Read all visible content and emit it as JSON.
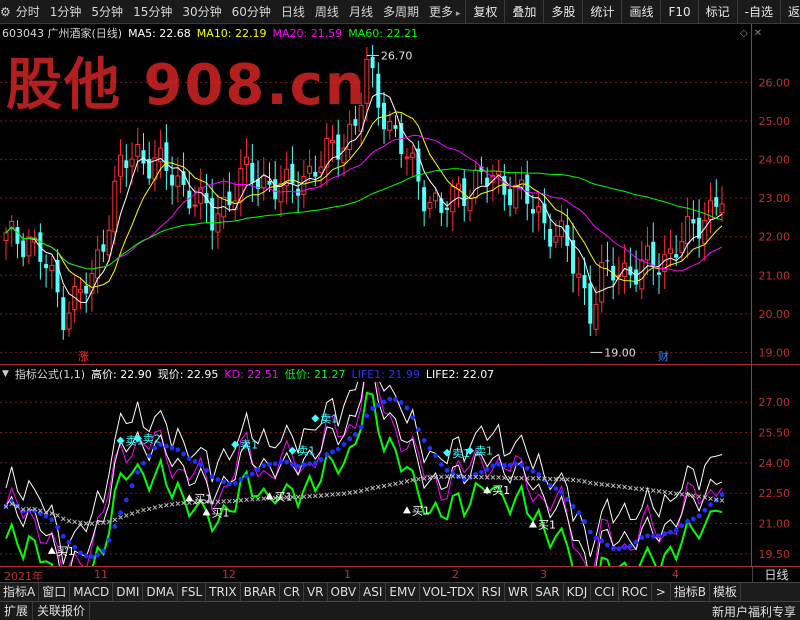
{
  "toolbar": {
    "periods": [
      "分时",
      "1分钟",
      "5分钟",
      "15分钟",
      "30分钟",
      "60分钟",
      "日线",
      "周线",
      "月线",
      "多周期",
      "更多"
    ],
    "tools": [
      "复权",
      "叠加",
      "多股",
      "统计",
      "画线",
      "F10",
      "标记",
      "-自选",
      "返回"
    ]
  },
  "watermark": "股他 908.cn",
  "main_legend": {
    "stock": "603043 广州酒家(日线)",
    "items": [
      {
        "label": "MA5: 22.68",
        "color": "#ffffff"
      },
      {
        "label": "MA10: 22.19",
        "color": "#ffff00"
      },
      {
        "label": "MA20: 21.59",
        "color": "#ff00ff"
      },
      {
        "label": "MA60: 22.21",
        "color": "#00ff00"
      }
    ]
  },
  "indicator_legend": {
    "name": "指标公式(1,1)",
    "items": [
      {
        "label": "高价: 22.90",
        "color": "#ffffff"
      },
      {
        "label": "现价: 22.95",
        "color": "#ffffff"
      },
      {
        "label": "KD: 22.51",
        "color": "#ff00ff"
      },
      {
        "label": "低价: 21.27",
        "color": "#00ff00"
      },
      {
        "label": "LIFE1: 21.99",
        "color": "#3030ff"
      },
      {
        "label": "LIFE2: 22.07",
        "color": "#ffffff"
      }
    ]
  },
  "chart_data": {
    "type": "candlestick",
    "price_axis": {
      "ticks": [
        "26.00",
        "25.00",
        "24.00",
        "23.00",
        "22.00",
        "21.00",
        "20.00",
        "19.00"
      ],
      "range": [
        18.7,
        27.1
      ]
    },
    "indicator_axis": {
      "ticks": [
        "27.00",
        "25.50",
        "24.00",
        "22.50",
        "21.00",
        "19.50"
      ],
      "range": [
        18.9,
        28.0
      ]
    },
    "annotations": {
      "high": "26.70",
      "low": "19.00",
      "rise_tag": "涨",
      "fin_tag": "财"
    },
    "time_axis": [
      "2021年",
      "11",
      "12",
      "1",
      "2",
      "3",
      "4"
    ],
    "period_label": "日线",
    "signals": {
      "buy": [
        {
          "label": "买1",
          "x": 8,
          "v": 19.6
        },
        {
          "label": "买1",
          "x": 32,
          "v": 22.2
        },
        {
          "label": "买1",
          "x": 35,
          "v": 21.5
        },
        {
          "label": "买1",
          "x": 46,
          "v": 22.3
        },
        {
          "label": "买1",
          "x": 70,
          "v": 21.6
        },
        {
          "label": "买1",
          "x": 84,
          "v": 22.6
        },
        {
          "label": "买1",
          "x": 92,
          "v": 20.9
        },
        {
          "label": "买1",
          "x": 95,
          "v": 18.6
        }
      ],
      "sell": [
        {
          "label": "卖1",
          "x": 20,
          "v": 25.1
        },
        {
          "label": "卖1",
          "x": 40,
          "v": 24.9
        },
        {
          "label": "卖1",
          "x": 50,
          "v": 24.6
        },
        {
          "label": "卖1",
          "x": 54,
          "v": 26.2
        },
        {
          "label": "卖1",
          "x": 77,
          "v": 24.5
        },
        {
          "label": "卖1",
          "x": 81,
          "v": 24.6
        }
      ],
      "sell2": [
        {
          "label": "卖2",
          "x": 23,
          "v": 25.2
        }
      ]
    }
  },
  "indicator_tabs": [
    "指标A",
    "窗口",
    "MACD",
    "DMI",
    "DMA",
    "FSL",
    "TRIX",
    "BRAR",
    "CR",
    "VR",
    "OBV",
    "ASI",
    "EMV",
    "VOL-TDX",
    "RSI",
    "WR",
    "SAR",
    "KDJ",
    "CCI",
    "ROC",
    "指标B",
    "模板"
  ],
  "bottom": {
    "expand": "扩展",
    "related": "关联报价",
    "promo": "新用户福利专享"
  }
}
